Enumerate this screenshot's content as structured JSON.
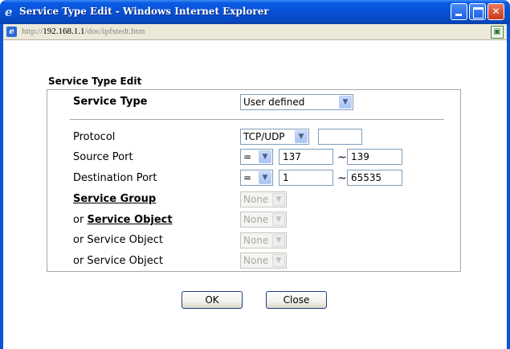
{
  "window": {
    "title": "Service Type Edit - Windows Internet Explorer",
    "minimize_glyph": "",
    "maximize_glyph": "",
    "close_glyph": "✕"
  },
  "address": {
    "scheme": "http://",
    "host": "192.168.1.1",
    "path": "/doc/ipfstedt.htm"
  },
  "form": {
    "section_title": "Service Type Edit",
    "service_type_label": "Service Type",
    "service_type_value": "User defined",
    "protocol_label": "Protocol",
    "protocol_value": "TCP/UDP",
    "protocol_number": "",
    "source_port_label": "Source Port",
    "source_op": "=",
    "source_start": "137",
    "source_end": "139",
    "dest_port_label": "Destination Port",
    "dest_op": "=",
    "dest_start": "1",
    "dest_end": "65535",
    "tilde": "~",
    "service_group_label": "Service Group",
    "service_group_value": "None",
    "or_prefix": "or",
    "service_object_label": "Service Object",
    "service_object_1_value": "None",
    "service_object_2_label": "or Service Object",
    "service_object_2_value": "None",
    "service_object_3_label": "or Service Object",
    "service_object_3_value": "None"
  },
  "buttons": {
    "ok": "OK",
    "close": "Close"
  },
  "icons": {
    "title": "ie-icon",
    "address": "page-icon",
    "compat": "compat-view-icon",
    "dropdown": "chevron-down-icon"
  }
}
